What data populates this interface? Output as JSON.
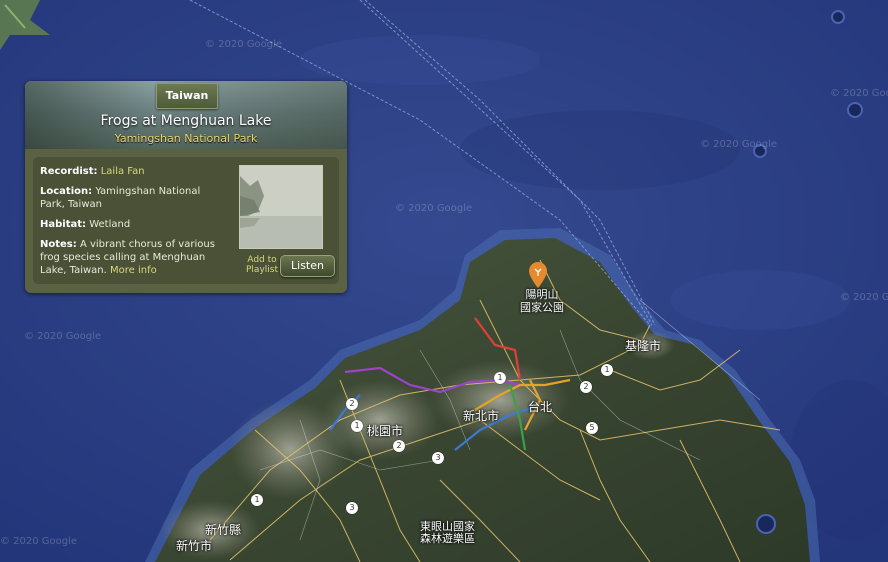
{
  "card": {
    "region": "Taiwan",
    "title": "Frogs at Menghuan Lake",
    "subtitle": "Yamingshan National Park",
    "recordist_label": "Recordist:",
    "recordist": "Laila Fan",
    "location_label": "Location:",
    "location": "Yamingshan National Park, Taiwan",
    "habitat_label": "Habitat:",
    "habitat": "Wetland",
    "notes_label": "Notes:",
    "notes": "A vibrant chorus of various frog species calling at Menghuan Lake, Taiwan.",
    "more_info": "More info",
    "add_to_playlist": "Add to Playlist",
    "listen": "Listen"
  },
  "map": {
    "labels": {
      "yangmingshan": "陽明山\n國家公園",
      "keelung": "基隆市",
      "taipei": "台北",
      "new_taipei": "新北市",
      "taoyuan": "桃園市",
      "hsinchu_county": "新竹縣",
      "hsinchu_city": "新竹市",
      "dongyanshan": "東眼山國家\n森林遊樂區"
    },
    "watermark": "© 2020 Google",
    "route_shields": [
      "1",
      "1",
      "2",
      "2",
      "2",
      "1",
      "3",
      "3",
      "3",
      "5",
      "1"
    ],
    "colors": {
      "sea": "#2d4189",
      "land": "#3e4a34",
      "pin": "#e58a2f"
    }
  }
}
